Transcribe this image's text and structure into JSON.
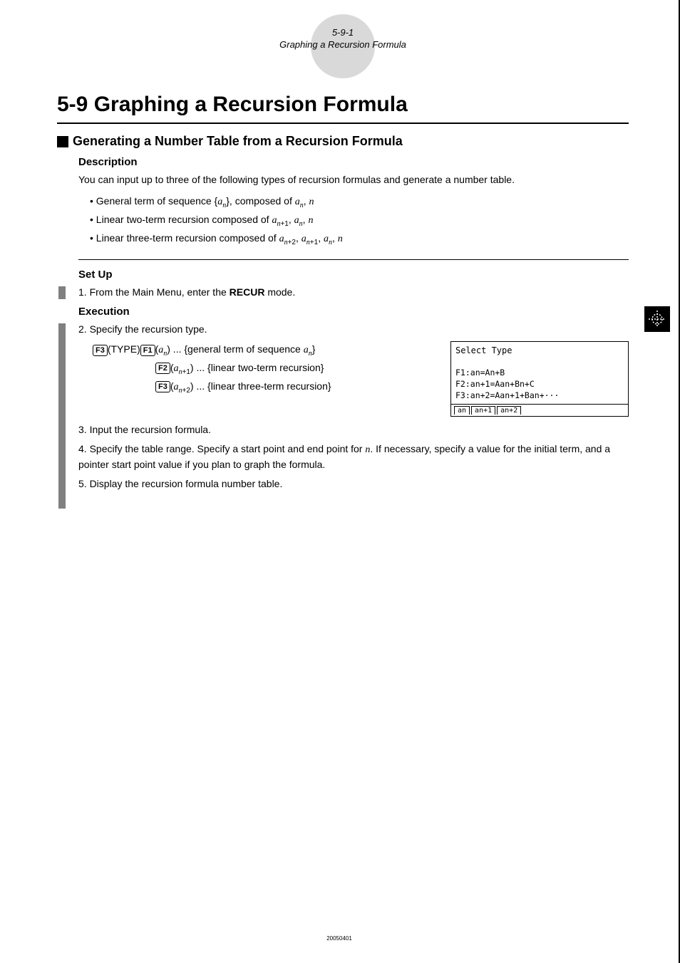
{
  "header": {
    "pageNum": "5-9-1",
    "pageTitle": "Graphing a Recursion Formula"
  },
  "title": "5-9  Graphing a Recursion Formula",
  "section": {
    "heading": "Generating a Number Table from a Recursion Formula",
    "descLabel": "Description",
    "descText": "You can input up to three of the following types of recursion formulas and generate a number table.",
    "bullets": {
      "b1_pre": "General term of sequence {",
      "b1_mid": "}, composed of ",
      "b2_pre": "Linear two-term recursion composed of ",
      "b3_pre": "Linear three-term recursion composed of "
    }
  },
  "setup": {
    "label": "Set Up",
    "step1_pre": "1. From the Main Menu, enter the ",
    "step1_bold": "RECUR",
    "step1_post": " mode."
  },
  "exec": {
    "label": "Execution",
    "step2": "2. Specify the recursion type.",
    "typeKey": "F3",
    "typeText": "(TYPE)",
    "f1Key": "F1",
    "f1Text": ") ... {general term of sequence ",
    "f2Key": "F2",
    "f2Text": ") ... {linear two-term recursion}",
    "f3Key": "F3",
    "f3Text": ") ... {linear three-term recursion}",
    "step3": "3. Input the recursion formula.",
    "step4_pre": "4. Specify the table range. Specify a start point and end point for ",
    "step4_post": ". If necessary, specify a value for the initial term, and a pointer start point value if you plan to graph the formula.",
    "step5": "5. Display the recursion formula number table."
  },
  "screen": {
    "title": "Select Type",
    "line1": "F1:an=An+B",
    "line2": "F2:an+1=Aan+Bn+C",
    "line3": "F3:an+2=Aan+1+Ban+···",
    "tab1": "an",
    "tab2": "an+1",
    "tab3": "an+2"
  },
  "footer": "20050401"
}
